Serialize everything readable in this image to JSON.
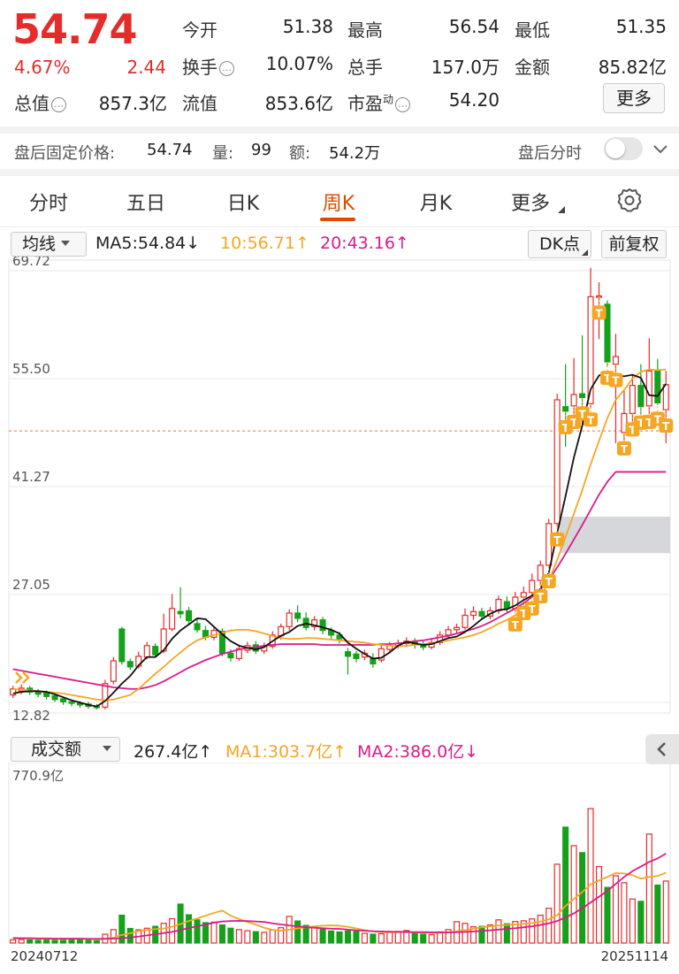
{
  "quote": {
    "price": "54.74",
    "change_pct": "4.67%",
    "change_amt": "2.44",
    "rows": [
      {
        "label": "今开",
        "value": "51.38",
        "color": "green"
      },
      {
        "label": "最高",
        "value": "56.54",
        "color": "red"
      },
      {
        "label": "最低",
        "value": "51.35",
        "color": "green"
      },
      {
        "label": "换手",
        "value": "10.07%",
        "color": "dark"
      },
      {
        "label": "总手",
        "value": "157.0万",
        "color": "dark"
      },
      {
        "label": "金额",
        "value": "85.82亿",
        "color": "dark"
      },
      {
        "label": "总值",
        "value": "857.3亿",
        "color": "dark"
      },
      {
        "label": "流值",
        "value": "853.6亿",
        "color": "dark"
      },
      {
        "label": "市盈",
        "value": "54.20",
        "color": "dark"
      }
    ],
    "pe_superscript": "动",
    "more_button": "更多"
  },
  "after_hours": {
    "fixed_price_label": "盘后固定价格:",
    "fixed_price": "54.74",
    "volume_label": "量:",
    "volume": "99",
    "amount_label": "额:",
    "amount": "54.2万",
    "timeshare_label": "盘后分时",
    "toggle_on": false
  },
  "tabs": [
    {
      "label": "分时",
      "active": false
    },
    {
      "label": "五日",
      "active": false
    },
    {
      "label": "日K",
      "active": false
    },
    {
      "label": "周K",
      "active": true
    },
    {
      "label": "月K",
      "active": false
    },
    {
      "label": "更多",
      "active": false
    }
  ],
  "indicators": {
    "select": "均线",
    "ma5": "MA5:54.84",
    "ma5_arrow": "↓",
    "ma10": "10:56.71",
    "ma10_arrow": "↑",
    "ma20": "20:43.16",
    "ma20_arrow": "↑",
    "dk_button": "DK点",
    "adjust_button": "前复权"
  },
  "volume_header": {
    "select": "成交额",
    "value": "267.4亿",
    "value_arrow": "↑",
    "ma1": "MA1:303.7亿",
    "ma1_arrow": "↑",
    "ma2": "MA2:386.0亿",
    "ma2_arrow": "↓"
  },
  "colors": {
    "up": "#e62b2b",
    "down": "#15a11b",
    "ma5": "#111111",
    "ma10": "#f5a623",
    "ma20": "#d81b8a",
    "accent": "#e04a00",
    "marker": "#f5a623"
  },
  "chart_data": [
    {
      "type": "candlestick",
      "y_ticks": [
        "69.72",
        "55.50",
        "41.27",
        "27.05",
        "12.82"
      ],
      "ylim": [
        12.82,
        69.72
      ],
      "last_price_line": 48.6,
      "bars": [
        {
          "o": 13.8,
          "c": 14.6,
          "h": 15.0,
          "l": 13.4
        },
        {
          "o": 14.3,
          "c": 14.7,
          "h": 15.2,
          "l": 13.9
        },
        {
          "o": 14.7,
          "c": 14.2,
          "h": 15.0,
          "l": 13.8
        },
        {
          "o": 14.2,
          "c": 13.9,
          "h": 14.6,
          "l": 13.5
        },
        {
          "o": 14.1,
          "c": 13.6,
          "h": 14.4,
          "l": 13.2
        },
        {
          "o": 13.7,
          "c": 13.2,
          "h": 14.0,
          "l": 12.9
        },
        {
          "o": 13.3,
          "c": 12.9,
          "h": 13.6,
          "l": 12.5
        },
        {
          "o": 12.9,
          "c": 12.7,
          "h": 13.2,
          "l": 12.3
        },
        {
          "o": 12.7,
          "c": 12.5,
          "h": 13.0,
          "l": 12.1
        },
        {
          "o": 12.6,
          "c": 12.3,
          "h": 12.9,
          "l": 12.0
        },
        {
          "o": 12.3,
          "c": 12.2,
          "h": 12.6,
          "l": 11.9
        },
        {
          "o": 12.2,
          "c": 15.3,
          "h": 15.8,
          "l": 11.9
        },
        {
          "o": 15.6,
          "c": 18.3,
          "h": 18.8,
          "l": 15.2
        },
        {
          "o": 22.5,
          "c": 18.2,
          "h": 22.8,
          "l": 17.8
        },
        {
          "o": 18.2,
          "c": 17.5,
          "h": 18.6,
          "l": 17.1
        },
        {
          "o": 17.6,
          "c": 18.9,
          "h": 19.5,
          "l": 17.3
        },
        {
          "o": 18.8,
          "c": 20.3,
          "h": 20.8,
          "l": 18.5
        },
        {
          "o": 20.2,
          "c": 19.1,
          "h": 20.6,
          "l": 18.8
        },
        {
          "o": 19.6,
          "c": 22.5,
          "h": 24.5,
          "l": 19.3
        },
        {
          "o": 22.5,
          "c": 25.2,
          "h": 27.1,
          "l": 22.2
        },
        {
          "o": 24.8,
          "c": 24.5,
          "h": 28.0,
          "l": 23.9
        },
        {
          "o": 24.9,
          "c": 23.6,
          "h": 25.4,
          "l": 23.1
        },
        {
          "o": 23.2,
          "c": 22.4,
          "h": 23.9,
          "l": 22.0
        },
        {
          "o": 22.3,
          "c": 21.4,
          "h": 22.9,
          "l": 21.0
        },
        {
          "o": 21.4,
          "c": 22.3,
          "h": 22.8,
          "l": 21.0
        },
        {
          "o": 22.2,
          "c": 19.3,
          "h": 22.6,
          "l": 18.9
        },
        {
          "o": 19.3,
          "c": 18.7,
          "h": 19.8,
          "l": 18.2
        },
        {
          "o": 18.6,
          "c": 19.9,
          "h": 20.3,
          "l": 18.3
        },
        {
          "o": 19.7,
          "c": 20.3,
          "h": 20.8,
          "l": 19.3
        },
        {
          "o": 20.4,
          "c": 19.6,
          "h": 20.9,
          "l": 19.2
        },
        {
          "o": 19.6,
          "c": 20.2,
          "h": 20.7,
          "l": 19.2
        },
        {
          "o": 20.2,
          "c": 21.7,
          "h": 22.2,
          "l": 19.9
        },
        {
          "o": 21.6,
          "c": 22.8,
          "h": 23.2,
          "l": 21.1
        },
        {
          "o": 22.8,
          "c": 24.6,
          "h": 25.1,
          "l": 22.3
        },
        {
          "o": 24.6,
          "c": 23.9,
          "h": 25.6,
          "l": 23.4
        },
        {
          "o": 23.9,
          "c": 22.7,
          "h": 24.7,
          "l": 22.3
        },
        {
          "o": 22.8,
          "c": 23.7,
          "h": 24.2,
          "l": 22.3
        },
        {
          "o": 23.7,
          "c": 22.3,
          "h": 24.1,
          "l": 21.8
        },
        {
          "o": 22.3,
          "c": 21.7,
          "h": 22.7,
          "l": 21.1
        },
        {
          "o": 21.7,
          "c": 21.2,
          "h": 22.1,
          "l": 20.6
        },
        {
          "o": 19.5,
          "c": 18.9,
          "h": 20.0,
          "l": 16.5
        },
        {
          "o": 19.2,
          "c": 18.6,
          "h": 19.6,
          "l": 18.1
        },
        {
          "o": 18.8,
          "c": 19.3,
          "h": 19.8,
          "l": 18.4
        },
        {
          "o": 18.6,
          "c": 17.9,
          "h": 19.3,
          "l": 17.4
        },
        {
          "o": 18.4,
          "c": 19.9,
          "h": 20.4,
          "l": 18.1
        },
        {
          "o": 19.8,
          "c": 20.3,
          "h": 20.8,
          "l": 19.3
        },
        {
          "o": 20.3,
          "c": 20.6,
          "h": 21.1,
          "l": 19.9
        },
        {
          "o": 20.6,
          "c": 20.9,
          "h": 21.4,
          "l": 20.1
        },
        {
          "o": 20.9,
          "c": 20.4,
          "h": 21.3,
          "l": 19.9
        },
        {
          "o": 20.4,
          "c": 20.1,
          "h": 20.9,
          "l": 19.7
        },
        {
          "o": 20.1,
          "c": 20.7,
          "h": 21.2,
          "l": 19.8
        },
        {
          "o": 20.7,
          "c": 21.7,
          "h": 22.2,
          "l": 20.4
        },
        {
          "o": 21.7,
          "c": 22.4,
          "h": 22.9,
          "l": 21.3
        },
        {
          "o": 22.4,
          "c": 22.7,
          "h": 23.2,
          "l": 21.9
        },
        {
          "o": 22.7,
          "c": 24.3,
          "h": 25.2,
          "l": 22.4
        },
        {
          "o": 24.3,
          "c": 24.8,
          "h": 25.5,
          "l": 23.7
        },
        {
          "o": 24.8,
          "c": 24.2,
          "h": 25.3,
          "l": 23.7
        },
        {
          "o": 24.2,
          "c": 24.9,
          "h": 25.4,
          "l": 23.8
        },
        {
          "o": 24.9,
          "c": 26.4,
          "h": 26.9,
          "l": 24.5
        },
        {
          "o": 26.1,
          "c": 25.2,
          "h": 26.8,
          "l": 24.7
        },
        {
          "o": 25.2,
          "c": 26.7,
          "h": 27.4,
          "l": 24.8
        },
        {
          "o": 26.7,
          "c": 27.3,
          "h": 28.1,
          "l": 26.2
        },
        {
          "o": 27.3,
          "c": 28.9,
          "h": 29.8,
          "l": 26.9
        },
        {
          "o": 28.9,
          "c": 30.9,
          "h": 31.5,
          "l": 28.2
        },
        {
          "o": 30.9,
          "c": 36.4,
          "h": 37.0,
          "l": 30.6
        },
        {
          "o": 36.4,
          "c": 52.7,
          "h": 53.5,
          "l": 36.0
        },
        {
          "o": 51.8,
          "c": 51.2,
          "h": 57.4,
          "l": 46.5
        },
        {
          "o": 51.9,
          "c": 53.4,
          "h": 58.2,
          "l": 50.4
        },
        {
          "o": 53.5,
          "c": 53.0,
          "h": 61.2,
          "l": 49.2
        },
        {
          "o": 52.2,
          "c": 66.3,
          "h": 70.1,
          "l": 51.6
        },
        {
          "o": 66.3,
          "c": 66.4,
          "h": 68.2,
          "l": 60.7
        },
        {
          "o": 65.3,
          "c": 57.7,
          "h": 65.8,
          "l": 57.0
        },
        {
          "o": 57.4,
          "c": 58.4,
          "h": 61.4,
          "l": 47.0
        },
        {
          "o": 48.4,
          "c": 50.9,
          "h": 54.1,
          "l": 46.0
        },
        {
          "o": 50.9,
          "c": 54.6,
          "h": 56.1,
          "l": 49.6
        },
        {
          "o": 54.6,
          "c": 51.8,
          "h": 57.4,
          "l": 50.8
        },
        {
          "o": 51.9,
          "c": 56.5,
          "h": 60.8,
          "l": 50.8
        },
        {
          "o": 56.5,
          "c": 52.3,
          "h": 58.1,
          "l": 52.0
        },
        {
          "o": 51.4,
          "c": 54.7,
          "h": 56.5,
          "l": 47.0
        }
      ],
      "ma5": [
        14.0,
        14.2,
        14.3,
        14.3,
        14.2,
        13.9,
        13.5,
        13.1,
        12.8,
        12.5,
        12.3,
        13.0,
        14.1,
        15.3,
        16.3,
        17.7,
        18.8,
        18.8,
        19.7,
        21.2,
        22.3,
        23.1,
        23.9,
        23.8,
        22.8,
        21.8,
        20.9,
        20.3,
        20.0,
        19.8,
        20.1,
        20.9,
        21.6,
        22.1,
        22.9,
        23.2,
        23.0,
        22.7,
        22.4,
        21.9,
        20.7,
        19.9,
        19.2,
        18.6,
        18.7,
        19.4,
        20.3,
        20.8,
        20.6,
        20.4,
        20.5,
        20.9,
        21.3,
        21.5,
        22.1,
        22.9,
        23.8,
        24.5,
        25.0,
        25.1,
        25.6,
        26.3,
        26.9,
        27.8,
        29.9,
        35.1,
        40.0,
        45.1,
        49.3,
        54.1,
        55.9,
        56.4,
        56.0,
        55.8,
        56.0,
        55.6,
        53.3,
        53.2,
        54.8
      ],
      "ma10": [
        14.6,
        14.5,
        14.4,
        14.3,
        14.2,
        14.1,
        14.0,
        13.8,
        13.6,
        13.4,
        13.2,
        13.1,
        13.2,
        13.5,
        13.8,
        14.6,
        15.6,
        16.6,
        17.5,
        18.5,
        19.4,
        20.3,
        21.0,
        21.4,
        21.7,
        22.0,
        22.3,
        22.4,
        22.4,
        22.2,
        21.9,
        21.6,
        21.3,
        21.2,
        21.2,
        21.3,
        21.3,
        21.2,
        21.1,
        21.0,
        20.9,
        20.8,
        20.7,
        20.5,
        20.4,
        20.3,
        20.2,
        20.3,
        20.4,
        20.5,
        20.6,
        20.8,
        21.0,
        21.2,
        21.4,
        21.7,
        22.1,
        22.6,
        23.2,
        23.7,
        24.3,
        24.9,
        25.6,
        26.8,
        28.8,
        31.6,
        34.6,
        37.7,
        40.8,
        44.2,
        47.3,
        50.3,
        52.7,
        54.0,
        55.5,
        56.4,
        56.7,
        56.6,
        56.7
      ],
      "ma20": [
        17.2,
        17.0,
        16.8,
        16.6,
        16.4,
        16.2,
        16.0,
        15.8,
        15.6,
        15.4,
        15.2,
        15.0,
        14.8,
        14.7,
        14.6,
        14.6,
        14.8,
        15.1,
        15.6,
        16.2,
        16.8,
        17.4,
        17.9,
        18.4,
        18.8,
        19.2,
        19.5,
        19.8,
        20.0,
        20.1,
        20.3,
        20.4,
        20.5,
        20.5,
        20.5,
        20.5,
        20.5,
        20.4,
        20.4,
        20.4,
        20.4,
        20.4,
        20.4,
        20.4,
        20.5,
        20.5,
        20.6,
        20.7,
        20.9,
        21.0,
        21.2,
        21.4,
        21.6,
        21.9,
        22.2,
        22.5,
        22.9,
        23.4,
        24.0,
        24.6,
        25.2,
        25.9,
        26.7,
        27.7,
        29.0,
        30.6,
        32.4,
        34.3,
        36.2,
        38.2,
        40.2,
        41.9,
        43.2,
        43.2,
        43.2,
        43.2,
        43.2,
        43.2,
        43.2
      ],
      "dk_markers_indices": [
        60,
        61,
        62,
        63,
        64,
        65,
        66,
        67,
        68,
        69,
        70,
        71,
        72,
        73,
        74,
        75,
        76,
        77,
        78
      ],
      "x_start_label": "20240712",
      "x_end_label": "20251114"
    },
    {
      "type": "bar",
      "unit": "亿",
      "y_max_label": "770.9亿",
      "ylim": [
        0,
        770.9
      ],
      "values": [
        14,
        15,
        13,
        12,
        16,
        12,
        18,
        16,
        14,
        11,
        10,
        38,
        58,
        120,
        63,
        57,
        64,
        72,
        85,
        105,
        168,
        122,
        100,
        88,
        90,
        78,
        64,
        58,
        53,
        49,
        46,
        56,
        66,
        115,
        95,
        76,
        70,
        60,
        52,
        48,
        52,
        50,
        42,
        38,
        40,
        46,
        50,
        54,
        42,
        38,
        36,
        48,
        58,
        92,
        85,
        70,
        72,
        78,
        100,
        83,
        93,
        96,
        104,
        120,
        150,
        340,
        500,
        420,
        390,
        580,
        330,
        240,
        290,
        260,
        190,
        180,
        470,
        250,
        267.4
      ],
      "ma1": [
        20,
        20,
        19,
        18,
        18,
        17,
        17,
        18,
        18,
        17,
        16,
        19,
        23,
        35,
        42,
        52,
        56,
        60,
        63,
        70,
        82,
        95,
        106,
        118,
        130,
        140,
        118,
        104,
        90,
        80,
        66,
        57,
        53,
        58,
        63,
        68,
        72,
        75,
        76,
        75,
        70,
        63,
        56,
        50,
        47,
        46,
        47,
        47,
        46,
        45,
        44,
        44,
        46,
        50,
        56,
        62,
        68,
        72,
        76,
        78,
        80,
        83,
        86,
        93,
        102,
        120,
        160,
        190,
        220,
        253,
        270,
        285,
        302,
        300,
        293,
        278,
        285,
        289,
        303.7
      ],
      "ma2": [
        22,
        21,
        21,
        20,
        20,
        19,
        19,
        19,
        19,
        18,
        18,
        18,
        19,
        21,
        24,
        28,
        33,
        38,
        43,
        48,
        56,
        65,
        72,
        80,
        88,
        93,
        95,
        96,
        95,
        93,
        91,
        85,
        80,
        76,
        72,
        68,
        66,
        64,
        62,
        61,
        58,
        55,
        53,
        51,
        50,
        49,
        48,
        48,
        47,
        47,
        46,
        46,
        46,
        47,
        48,
        50,
        52,
        55,
        58,
        61,
        64,
        68,
        72,
        78,
        85,
        95,
        110,
        128,
        150,
        175,
        200,
        225,
        255,
        285,
        310,
        330,
        350,
        365,
        386.0
      ]
    }
  ]
}
